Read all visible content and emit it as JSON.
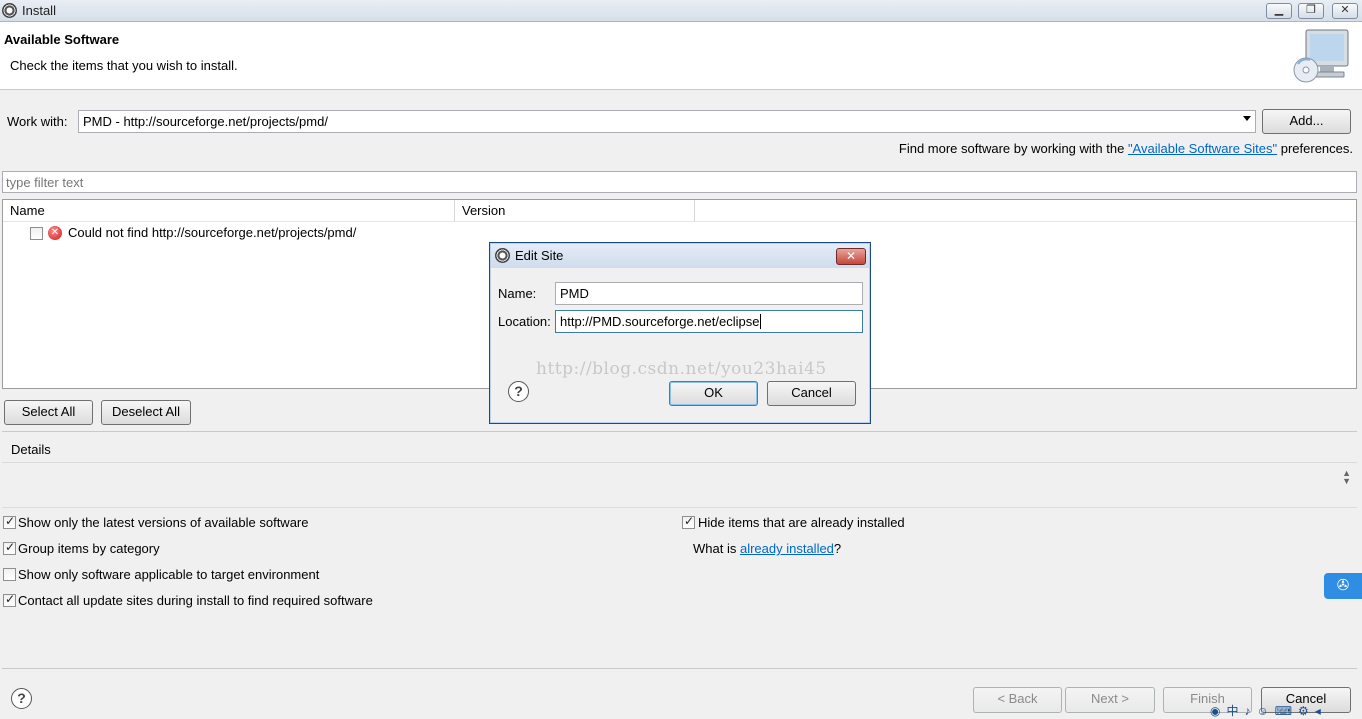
{
  "window": {
    "title": "Install"
  },
  "header": {
    "title": "Available Software",
    "subtitle": "Check the items that you wish to install."
  },
  "work_with": {
    "label": "Work with:",
    "value": "PMD - http://sourceforge.net/projects/pmd/",
    "add_label": "Add...",
    "find_more_prefix": "Find more software by working with the ",
    "find_more_link": "\"Available Software Sites\"",
    "find_more_suffix": " preferences."
  },
  "filter": {
    "placeholder": "type filter text"
  },
  "table": {
    "columns": [
      "Name",
      "Version"
    ],
    "rows": [
      {
        "name": "Could not find http://sourceforge.net/projects/pmd/",
        "version": "",
        "checked": false,
        "status": "error"
      }
    ]
  },
  "selection": {
    "select_all": "Select All",
    "deselect_all": "Deselect All"
  },
  "details": {
    "label": "Details"
  },
  "options": {
    "latest_versions": {
      "label": "Show only the latest versions of available software",
      "checked": true
    },
    "group_by_category": {
      "label": "Group items by category",
      "checked": true
    },
    "target_env": {
      "label": "Show only software applicable to target environment",
      "checked": false
    },
    "contact_sites": {
      "label": "Contact all update sites during install to find required software",
      "checked": true
    },
    "hide_installed": {
      "label": "Hide items that are already installed",
      "checked": true
    },
    "what_is_prefix": "What is ",
    "what_is_link": "already installed",
    "what_is_suffix": "?"
  },
  "footer": {
    "back": "< Back",
    "next": "Next >",
    "finish": "Finish",
    "cancel": "Cancel"
  },
  "dialog": {
    "title": "Edit Site",
    "name_label": "Name:",
    "name_value": "PMD",
    "location_label": "Location:",
    "location_value": "http://PMD.sourceforge.net/eclipse",
    "watermark": "http://blog.csdn.net/you23hai45",
    "ok": "OK",
    "cancel": "Cancel"
  },
  "colors": {
    "link": "#0066cc",
    "dialog_border": "#1c4c7f",
    "error": "#d41818"
  }
}
